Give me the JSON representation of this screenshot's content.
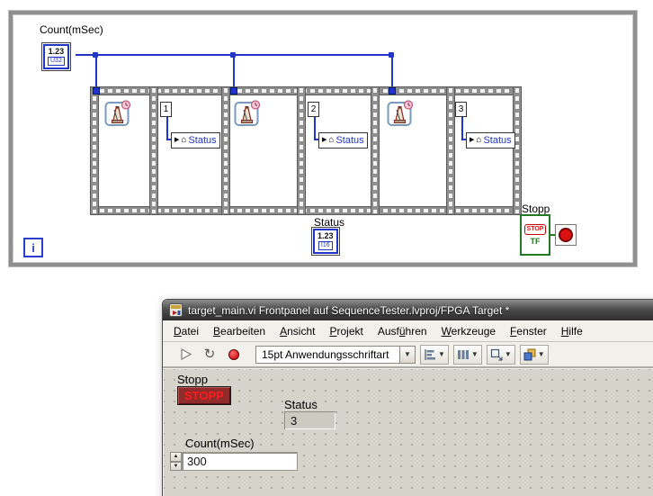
{
  "colors": {
    "wire_blue": "#2136c8",
    "bool_green": "#237a23",
    "stop_red": "#dd1111",
    "maroon_bg": "#8f2b2b",
    "stop_text_red": "#ff1c1c",
    "panel_gray": "#d6d3ca",
    "chrome_gray": "#f2f0ea"
  },
  "diagram": {
    "count_label": "Count(mSec)",
    "count_terminal": {
      "value": "1.23",
      "type": "U32"
    },
    "frames": [
      {
        "type": "wait"
      },
      {
        "type": "local",
        "constant": "1",
        "local_name": "Status"
      },
      {
        "type": "wait"
      },
      {
        "type": "local",
        "constant": "2",
        "local_name": "Status"
      },
      {
        "type": "wait"
      },
      {
        "type": "local",
        "constant": "3",
        "local_name": "Status"
      }
    ],
    "status_label": "Status",
    "status_terminal": {
      "value": "1.23",
      "type": "I16"
    },
    "stop_label": "Stopp",
    "stop_terminal": {
      "text": "STOP",
      "type_text": "TF"
    },
    "iteration_label": "i"
  },
  "window": {
    "title": "target_main.vi Frontpanel auf SequenceTester.lvproj/FPGA Target *",
    "menus": [
      {
        "label": "Datei",
        "u": 0
      },
      {
        "label": "Bearbeiten",
        "u": 0
      },
      {
        "label": "Ansicht",
        "u": 0
      },
      {
        "label": "Projekt",
        "u": 0
      },
      {
        "label": "Ausführen",
        "u": 4
      },
      {
        "label": "Werkzeuge",
        "u": 0
      },
      {
        "label": "Fenster",
        "u": 0
      },
      {
        "label": "Hilfe",
        "u": 0
      }
    ],
    "toolbar": {
      "font_selector": "15pt Anwendungsschriftart"
    },
    "panel": {
      "stop_label": "Stopp",
      "stop_button_text": "STOPP",
      "status_label": "Status",
      "status_value": "3",
      "count_label": "Count(mSec)",
      "count_value": "300"
    }
  }
}
